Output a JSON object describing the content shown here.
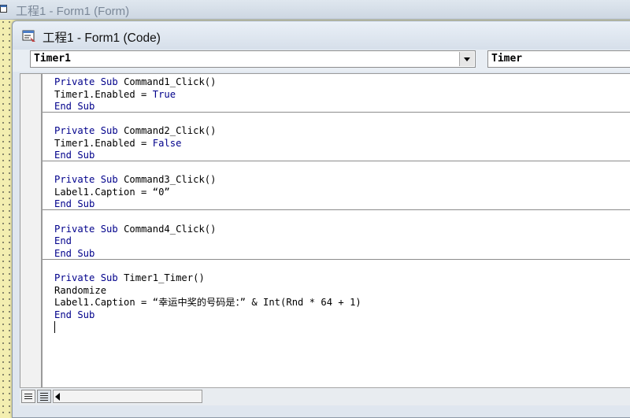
{
  "back_window": {
    "title": "工程1 - Form1 (Form)"
  },
  "code_window": {
    "title": "工程1 - Form1 (Code)",
    "object_combo": {
      "value": "Timer1"
    },
    "procedure_combo": {
      "value": "Timer"
    }
  },
  "code": {
    "blocks": [
      {
        "line1": {
          "kw": "Private Sub ",
          "text": "Command1_Click()"
        },
        "line2": {
          "text": "Timer1.Enabled = ",
          "kw": "True"
        },
        "line3": {
          "kw": "End Sub"
        }
      },
      {
        "line1": {
          "kw": "Private Sub ",
          "text": "Command2_Click()"
        },
        "line2": {
          "text": "Timer1.Enabled = ",
          "kw": "False"
        },
        "line3": {
          "kw": "End Sub"
        }
      },
      {
        "line1": {
          "kw": "Private Sub ",
          "text": "Command3_Click()"
        },
        "line2": {
          "text": "Label1.Caption = “0”"
        },
        "line3": {
          "kw": "End Sub"
        }
      },
      {
        "line1": {
          "kw": "Private Sub ",
          "text": "Command4_Click()"
        },
        "line2": {
          "kw": "End"
        },
        "line3": {
          "kw": "End Sub"
        }
      },
      {
        "line1": {
          "kw": "Private Sub ",
          "text": "Timer1_Timer()"
        },
        "line2": {
          "text": "Randomize"
        },
        "line3": {
          "text": "Label1.Caption = “幸运中奖的号码是：” & Int(Rnd * 64 + 1)"
        },
        "line4": {
          "kw": "End Sub"
        }
      }
    ]
  },
  "icons": {
    "back_window_icon": "form-window-icon",
    "code_window_icon": "code-window-icon",
    "procedure_view": "procedure-view-icon",
    "full_module_view": "full-module-view-icon",
    "scroll_left": "scroll-left-arrow-icon"
  },
  "colors": {
    "keyword": "#00008b",
    "designer_grid": "#f3eeb0"
  }
}
